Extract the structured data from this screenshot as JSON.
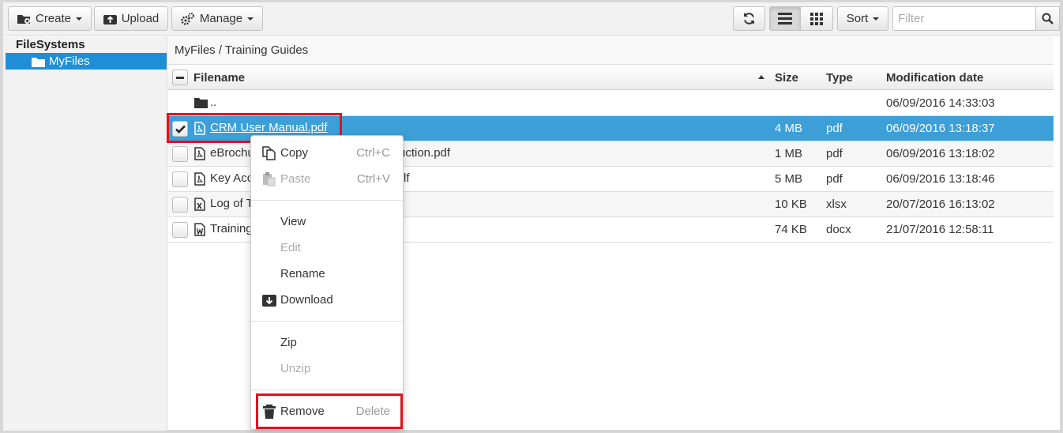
{
  "toolbar": {
    "create_label": "Create",
    "upload_label": "Upload",
    "manage_label": "Manage",
    "sort_label": "Sort",
    "filter_placeholder": "Filter"
  },
  "sidebar": {
    "root_label": "FileSystems",
    "items": [
      {
        "label": "MyFiles",
        "selected": true
      }
    ]
  },
  "breadcrumb": "MyFiles / Training Guides",
  "grid": {
    "columns": {
      "filename": "Filename",
      "size": "Size",
      "type": "Type",
      "modified": "Modification date"
    },
    "rows": [
      {
        "name": "..",
        "size": "",
        "type": "",
        "modified": "06/09/2016 14:33:03",
        "icon": "folder-icon"
      },
      {
        "name": "CRM User Manual.pdf",
        "size": "4 MB",
        "type": "pdf",
        "modified": "06/09/2016 13:18:37",
        "icon": "pdf-icon",
        "selected": true
      },
      {
        "name": "eBrochu",
        "name_tail": "uction.pdf",
        "size": "1 MB",
        "type": "pdf",
        "modified": "06/09/2016 13:18:02",
        "icon": "pdf-icon"
      },
      {
        "name": "Key Acc",
        "name_tail": "lf",
        "size": "5 MB",
        "type": "pdf",
        "modified": "06/09/2016 13:18:46",
        "icon": "pdf-icon"
      },
      {
        "name": "Log of T",
        "size": "10 KB",
        "type": "xlsx",
        "modified": "20/07/2016 16:13:02",
        "icon": "excel-icon"
      },
      {
        "name": "Training",
        "size": "74 KB",
        "type": "docx",
        "modified": "21/07/2016 12:58:11",
        "icon": "word-icon"
      }
    ]
  },
  "context_menu": {
    "copy": {
      "label": "Copy",
      "shortcut": "Ctrl+C"
    },
    "paste": {
      "label": "Paste",
      "shortcut": "Ctrl+V"
    },
    "view": "View",
    "edit": "Edit",
    "rename": "Rename",
    "download": "Download",
    "zip": "Zip",
    "unzip": "Unzip",
    "remove": {
      "label": "Remove",
      "shortcut": "Delete"
    }
  },
  "colors": {
    "accent": "#1e8fd6",
    "selected_row": "#3d9fd8",
    "highlight": "#e0141e"
  }
}
